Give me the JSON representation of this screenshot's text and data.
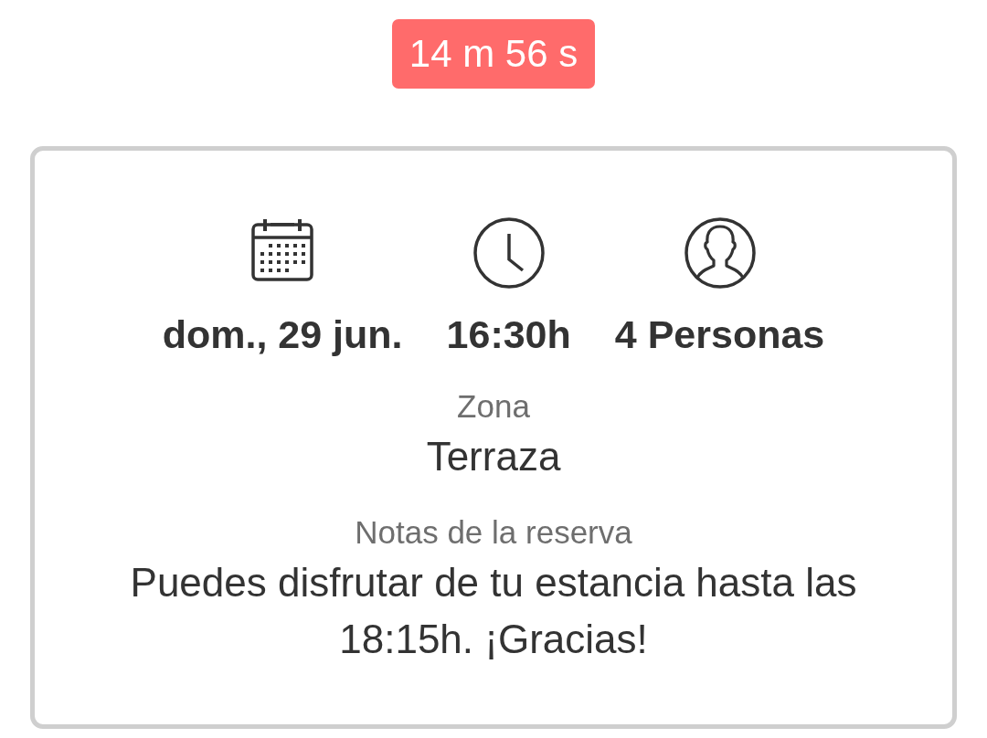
{
  "timer": {
    "text": "14 m 56 s"
  },
  "reservation": {
    "details": [
      {
        "kind": "date",
        "text": "dom., 29 jun."
      },
      {
        "kind": "time",
        "text": "16:30h"
      },
      {
        "kind": "guests",
        "text": "4 Personas"
      }
    ],
    "fields": [
      {
        "label": "Zona",
        "value": "Terraza"
      },
      {
        "label": "Notas de la reserva",
        "value": "Puedes disfrutar de tu estancia hasta las 18:15h. ¡Gracias!"
      }
    ]
  }
}
